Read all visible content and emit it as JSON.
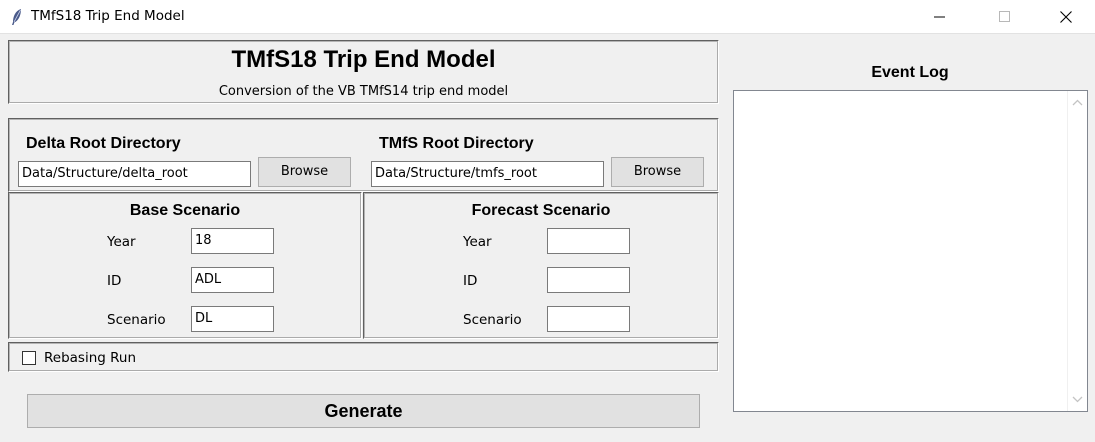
{
  "window": {
    "title": "TMfS18 Trip End Model"
  },
  "header": {
    "title": "TMfS18 Trip End Model",
    "subtitle": "Conversion of the VB TMfS14 trip end model"
  },
  "directories": {
    "delta": {
      "label": "Delta Root Directory",
      "value": "Data/Structure/delta_root",
      "button": "Browse"
    },
    "tmfs": {
      "label": "TMfS Root Directory",
      "value": "Data/Structure/tmfs_root",
      "button": "Browse"
    }
  },
  "base_scenario": {
    "title": "Base Scenario",
    "fields": [
      {
        "label": "Year",
        "value": "18"
      },
      {
        "label": "ID",
        "value": "ADL"
      },
      {
        "label": "Scenario",
        "value": "DL"
      }
    ]
  },
  "forecast_scenario": {
    "title": "Forecast Scenario",
    "fields": [
      {
        "label": "Year",
        "value": ""
      },
      {
        "label": "ID",
        "value": ""
      },
      {
        "label": "Scenario",
        "value": ""
      }
    ]
  },
  "rebasing": {
    "label": "Rebasing Run",
    "checked": false
  },
  "generate": {
    "label": "Generate"
  },
  "event_log": {
    "title": "Event Log",
    "content": ""
  }
}
